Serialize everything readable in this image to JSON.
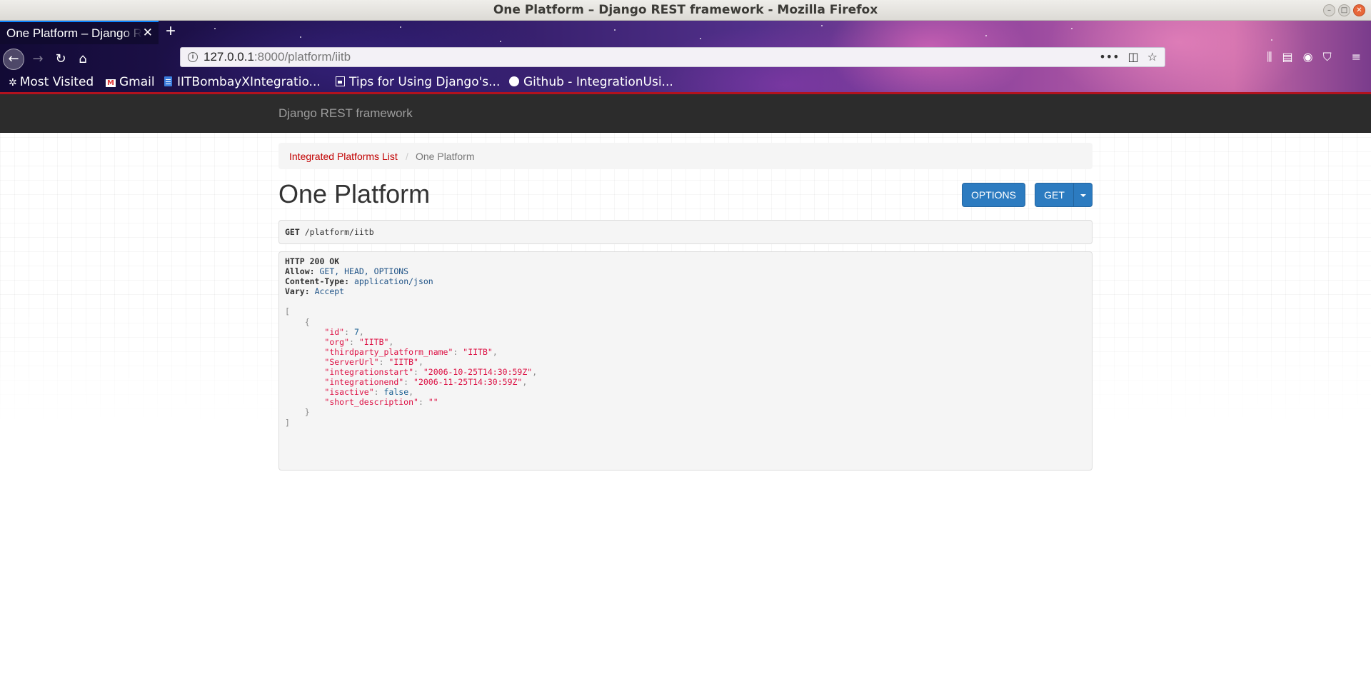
{
  "window": {
    "title": "One Platform – Django REST framework - Mozilla Firefox"
  },
  "tab": {
    "title": "One Platform – Django REST framework"
  },
  "urlbar": {
    "host": "127.0.0.1",
    "rest": ":8000/platform/iitb"
  },
  "bookmarks": [
    {
      "label": "Most Visited",
      "icon": "gear-icon"
    },
    {
      "label": "Gmail",
      "icon": "gmail-icon"
    },
    {
      "label": "IITBombayXIntegratio...",
      "icon": "doc-icon"
    },
    {
      "label": "Tips for Using Django's...",
      "icon": "page-icon"
    },
    {
      "label": "Github - IntegrationUsi...",
      "icon": "github-icon"
    }
  ],
  "navbar": {
    "brand": "Django REST framework"
  },
  "breadcrumb": {
    "link": "Integrated Platforms List",
    "separator": "/",
    "active": "One Platform"
  },
  "page": {
    "title": "One Platform"
  },
  "buttons": {
    "options": "OPTIONS",
    "get": "GET"
  },
  "request": {
    "method": "GET",
    "path": "/platform/iitb"
  },
  "response": {
    "status": "HTTP 200 OK",
    "headers": [
      {
        "key": "Allow:",
        "value": "GET, HEAD, OPTIONS"
      },
      {
        "key": "Content-Type:",
        "value": "application/json"
      },
      {
        "key": "Vary:",
        "value": "Accept"
      }
    ],
    "body": {
      "id": "7",
      "org": "\"IITB\"",
      "thirdparty_platform_name": "\"IITB\"",
      "ServerUrl": "\"IITB\"",
      "integrationstart": "\"2006-10-25T14:30:59Z\"",
      "integrationend": "\"2006-11-25T14:30:59Z\"",
      "isactive": "false",
      "short_description": "\"\""
    },
    "body_keys": {
      "id": "\"id\"",
      "org": "\"org\"",
      "thirdparty_platform_name": "\"thirdparty_platform_name\"",
      "ServerUrl": "\"ServerUrl\"",
      "integrationstart": "\"integrationstart\"",
      "integrationend": "\"integrationend\"",
      "isactive": "\"isactive\"",
      "short_description": "\"short_description\""
    }
  }
}
